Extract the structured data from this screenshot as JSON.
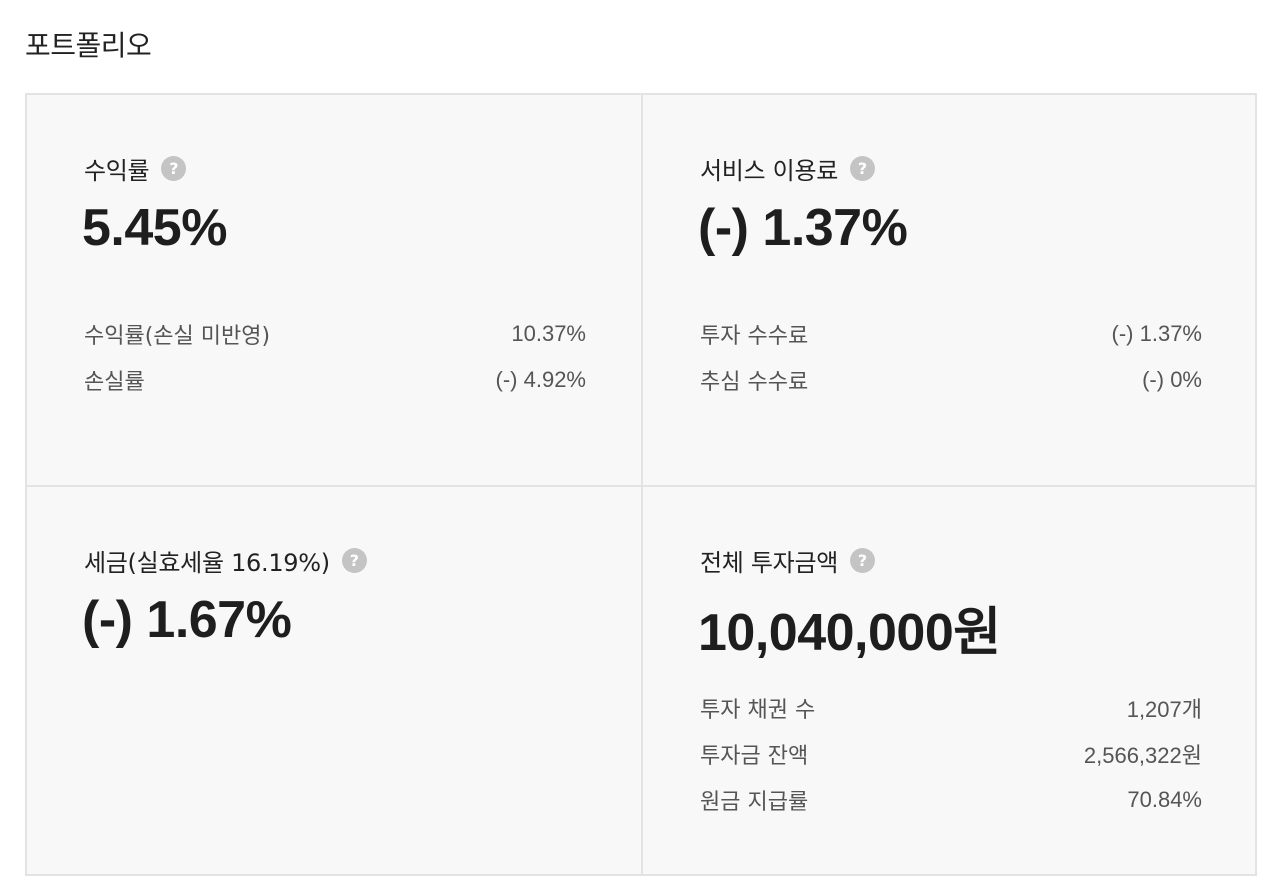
{
  "page": {
    "title": "포트폴리오"
  },
  "cards": {
    "return": {
      "label": "수익률",
      "value": "5.45%",
      "rows": [
        {
          "label": "수익률(손실 미반영)",
          "value": "10.37%"
        },
        {
          "label": "손실률",
          "value": "(-) 4.92%"
        }
      ]
    },
    "fee": {
      "label": "서비스 이용료",
      "value": "(-) 1.37%",
      "rows": [
        {
          "label": "투자 수수료",
          "value": "(-) 1.37%"
        },
        {
          "label": "추심 수수료",
          "value": "(-) 0%"
        }
      ]
    },
    "tax": {
      "label": "세금(실효세율 16.19%)",
      "value": "(-) 1.67%"
    },
    "total": {
      "label": "전체 투자금액",
      "value": "10,040,000원",
      "rows": [
        {
          "label": "투자 채권 수",
          "value": "1,207개"
        },
        {
          "label": "투자금 잔액",
          "value": "2,566,322원"
        },
        {
          "label": "원금 지급률",
          "value": "70.84%"
        }
      ]
    }
  },
  "icons": {
    "help": "question-mark-circle-icon"
  },
  "colors": {
    "card_bg": "#f8f8f8",
    "border": "#e3e3e3",
    "help_icon": "#c4c4c4",
    "text": "#222222",
    "subtext": "#555555"
  }
}
